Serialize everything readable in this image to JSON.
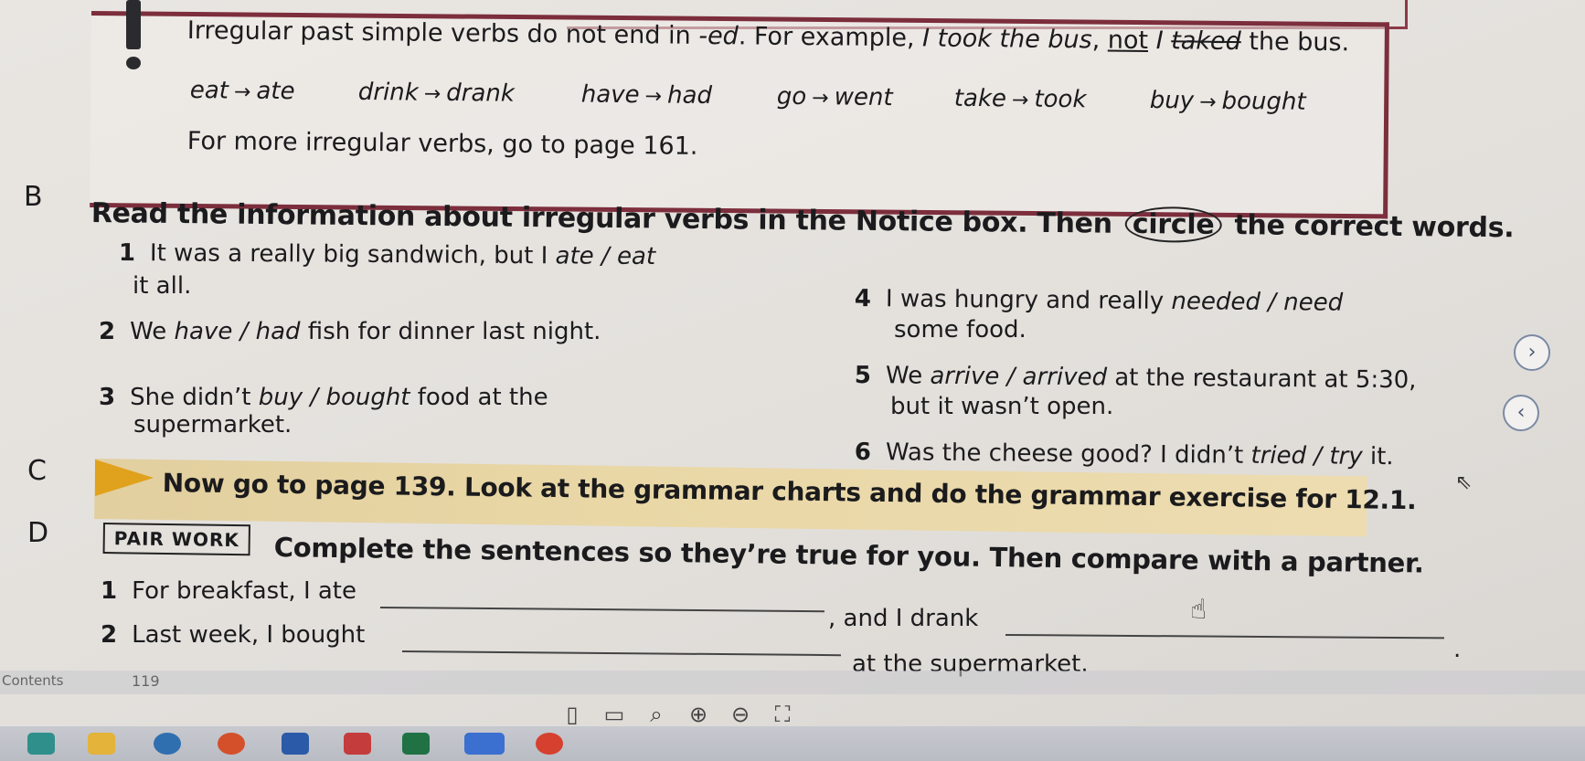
{
  "notice": {
    "line1_start": "Irregular past simple verbs do not end in ",
    "line1_ed": "-ed",
    "line1_mid": ". For example, ",
    "line1_example": "I took the bus",
    "line1_comma": ", ",
    "line1_not": "not",
    "line1_i": " I ",
    "line1_wrong": "taked",
    "line1_end": " the bus.",
    "verbs": [
      {
        "base": "eat",
        "past": "ate"
      },
      {
        "base": "drink",
        "past": "drank"
      },
      {
        "base": "have",
        "past": "had"
      },
      {
        "base": "go",
        "past": "went"
      },
      {
        "base": "take",
        "past": "took"
      },
      {
        "base": "buy",
        "past": "bought"
      }
    ],
    "arrow": "→",
    "line3": "For more irregular verbs, go to page 161."
  },
  "section_b": {
    "letter": "B",
    "instruction_start": "Read the information about irregular verbs in the Notice box. Then ",
    "instruction_circle": "circle",
    "instruction_end": " the correct words.",
    "items": [
      {
        "num": "1",
        "pre": "It was a really big sandwich, but I ",
        "opt": "ate / eat",
        "post": "",
        "cont": "it all."
      },
      {
        "num": "2",
        "pre": "We ",
        "opt": "have / had",
        "post": " fish for dinner last night.",
        "cont": ""
      },
      {
        "num": "3",
        "pre": "She didn’t ",
        "opt": "buy / bought",
        "post": " food at the",
        "cont": "supermarket."
      },
      {
        "num": "4",
        "pre": "I was hungry and really ",
        "opt": "needed / need",
        "post": "",
        "cont": "some food."
      },
      {
        "num": "5",
        "pre": "We ",
        "opt": "arrive / arrived",
        "post": " at the restaurant at 5:30,",
        "cont": "but it wasn’t open."
      },
      {
        "num": "6",
        "pre": "Was the cheese good? I didn’t ",
        "opt": "tried / try",
        "post": " it.",
        "cont": ""
      }
    ]
  },
  "section_c": {
    "letter": "C",
    "instruction": "Now go to page 139. Look at the grammar charts and do the grammar exercise for 12.1."
  },
  "section_d": {
    "letter": "D",
    "badge": "PAIR WORK",
    "instruction": "Complete the sentences so they’re true for you. Then compare with a partner.",
    "item1_num": "1",
    "item1_pre": "For breakfast, I ate",
    "item1_mid": ", and I drank",
    "item2_num": "2",
    "item2_pre": "Last week, I bought",
    "item2_end": "at the supermarket.",
    "period": "."
  },
  "footer": {
    "contents_label": "Contents",
    "page_number": "119"
  },
  "nav": {
    "next_glyph": "›",
    "prev_glyph": "‹"
  },
  "colors": {
    "notice_border": "#7c2e3c",
    "banner_fill": "#e6d3a3",
    "banner_arrow": "#e0a11c"
  }
}
